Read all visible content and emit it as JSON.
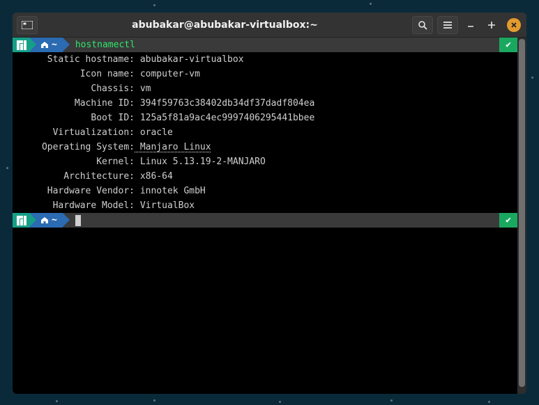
{
  "titlebar": {
    "title": "abubakar@abubakar-virtualbox:~"
  },
  "prompt": {
    "path": "~",
    "command": "hostnamectl",
    "status_glyph": "✔"
  },
  "output": [
    {
      "label": " Static hostname:",
      "value": " abubakar-virtualbox"
    },
    {
      "label": "       Icon name:",
      "value": " computer-vm"
    },
    {
      "label": "         Chassis:",
      "value": " vm"
    },
    {
      "label": "      Machine ID:",
      "value": " 394f59763c38402db34df37dadf804ea"
    },
    {
      "label": "         Boot ID:",
      "value": " 125a5f81a9ac4ec9997406295441bbee"
    },
    {
      "label": "  Virtualization:",
      "value": " oracle"
    },
    {
      "label": "Operating System:",
      "value": " Manjaro Linux",
      "underline": true
    },
    {
      "label": "          Kernel:",
      "value": " Linux 5.13.19-2-MANJARO"
    },
    {
      "label": "    Architecture:",
      "value": " x86-64"
    },
    {
      "label": " Hardware Vendor:",
      "value": " innotek GmbH"
    },
    {
      "label": "  Hardware Model:",
      "value": " VirtualBox"
    }
  ],
  "prompt2": {
    "path": "~",
    "status_glyph": "✔"
  }
}
